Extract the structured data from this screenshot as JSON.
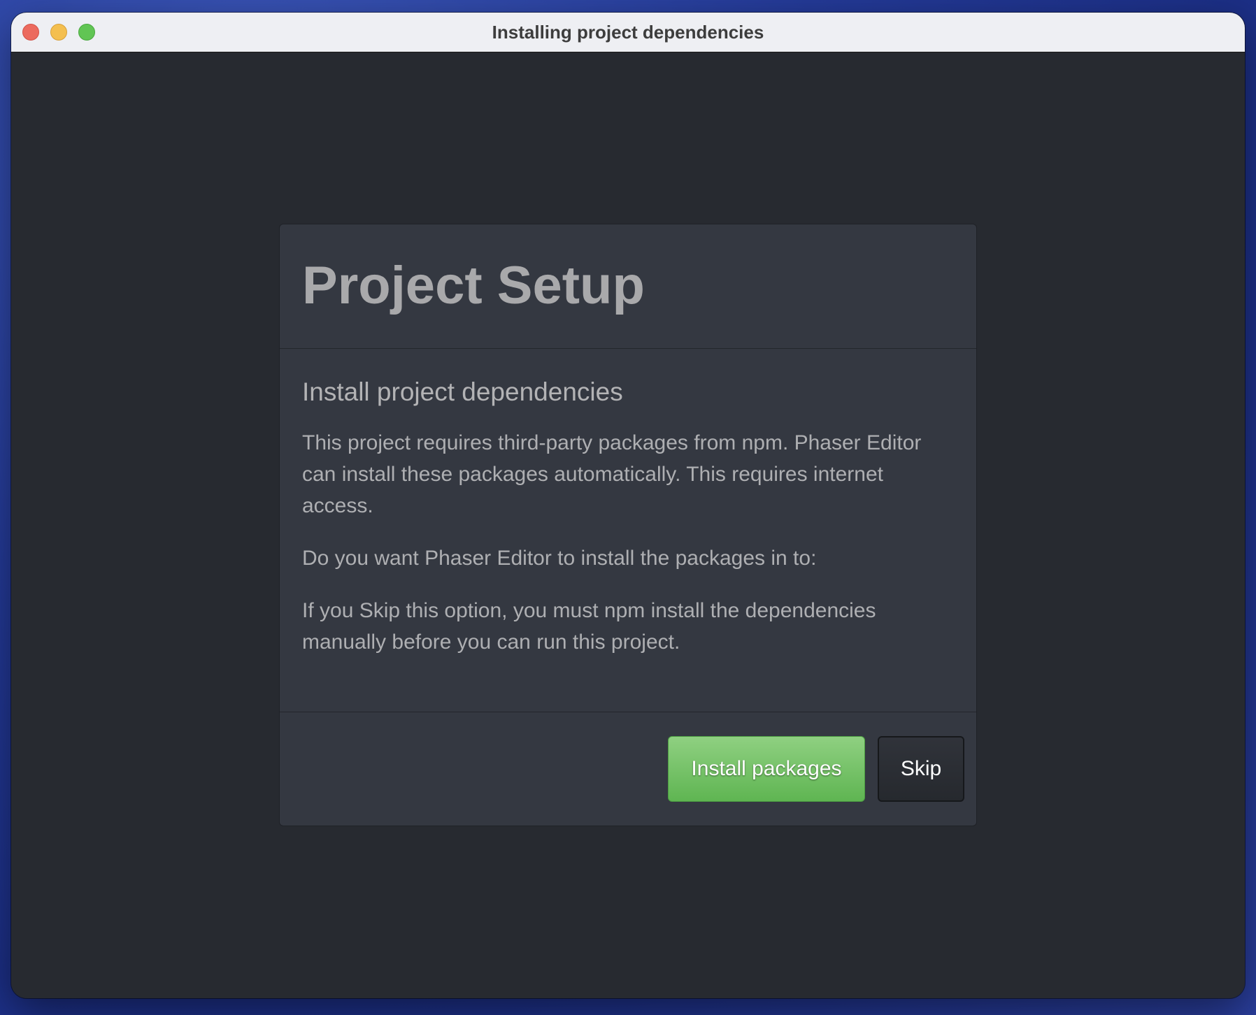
{
  "window": {
    "title": "Installing project dependencies",
    "controls": [
      "close",
      "minimize",
      "maximize"
    ]
  },
  "dialog": {
    "title": "Project Setup",
    "subtitle": "Install project dependencies",
    "paragraphs": [
      "This project requires third-party packages from npm. Phaser Editor can install these packages automatically. This requires internet access.",
      "Do you want Phaser Editor to install the packages in to:",
      "If you Skip this option, you must npm install the dependencies manually before you can run this project."
    ],
    "buttons": {
      "install_label": "Install packages",
      "skip_label": "Skip"
    }
  },
  "colors": {
    "background": "#272a30",
    "panel": "#343841",
    "primary_button": "#6cbd5e",
    "close_light": "#ec6a5e",
    "minimize_light": "#f4bf4f",
    "maximize_light": "#61c554"
  }
}
